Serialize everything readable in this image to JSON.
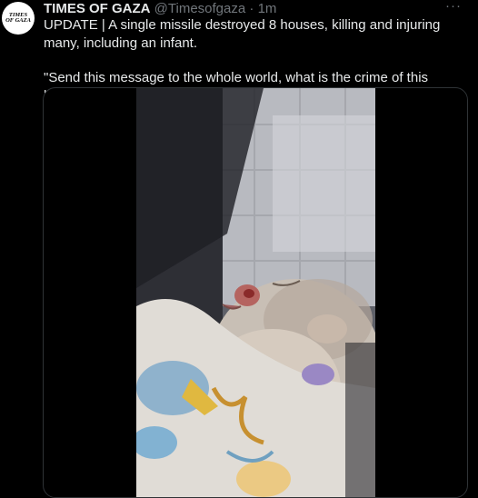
{
  "tweet": {
    "avatar_text": "TIMES OF GAZA",
    "author": "TIMES OF GAZA",
    "handle": "@Timesofgaza",
    "separator": "·",
    "time": "1m",
    "more_icon": "more-horizontal-icon",
    "text_line1": "UPDATE | A single missile destroyed 8 houses, killing and injuring many, including an infant.",
    "text_line2": "\"Send this message to the whole world, what is the crime of this baby?\""
  },
  "media": {
    "type": "video-still"
  },
  "colors": {
    "background": "#000000",
    "text": "#e7e9ea",
    "secondary": "#71767b",
    "border": "#2f3336"
  }
}
